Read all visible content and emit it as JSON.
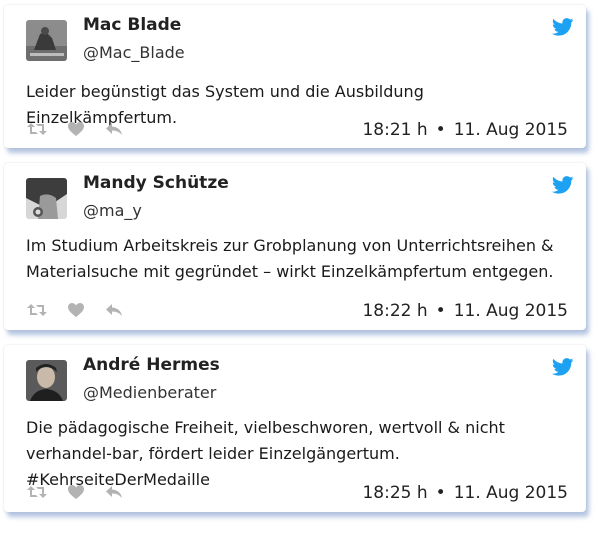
{
  "accent_color": "#1da1f2",
  "tweets": [
    {
      "name": "Mac Blade",
      "handle": "@Mac_Blade",
      "text": "Leider begünstigt das System und die Ausbildung Einzelkämpfertum.",
      "time": "18:21 h",
      "separator": "•",
      "date": "11. Aug 2015"
    },
    {
      "name": "Mandy Schütze",
      "handle": "@ma_y",
      "text": "Im Studium Arbeitskreis zur Grobplanung von Unterrichtsreihen & Materialsuche mit gegründet – wirkt Einzelkämpfertum entgegen.",
      "time": "18:22 h",
      "separator": "•",
      "date": "11. Aug 2015"
    },
    {
      "name": "André Hermes",
      "handle": "@Medienberater",
      "text": "Die pädagogische Freiheit, vielbeschworen, wertvoll & nicht verhandel-bar, fördert leider Einzelgängertum. #KehrseiteDerMedaille",
      "time": "18:25 h",
      "separator": "•",
      "date": "11. Aug 2015"
    }
  ],
  "icons": [
    "twitter-bird-icon",
    "retweet-icon",
    "like-heart-icon",
    "reply-icon"
  ]
}
